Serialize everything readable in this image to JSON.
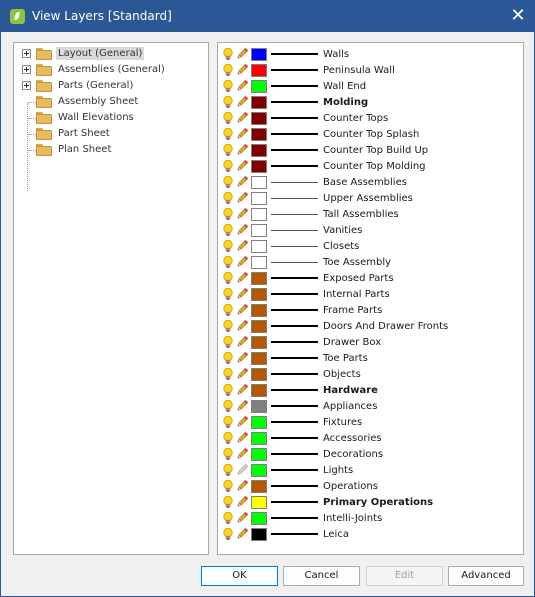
{
  "window": {
    "title": "View Layers [Standard]"
  },
  "colors": {
    "titlebar": "#2b5797",
    "accent": "#0078d7"
  },
  "tree": {
    "items": [
      {
        "label": "Layout (General)",
        "expandable": true,
        "selected": true
      },
      {
        "label": "Assemblies (General)",
        "expandable": true,
        "selected": false
      },
      {
        "label": "Parts (General)",
        "expandable": true,
        "selected": false
      },
      {
        "label": "Assembly Sheet",
        "expandable": false,
        "selected": false
      },
      {
        "label": "Wall Elevations",
        "expandable": false,
        "selected": false
      },
      {
        "label": "Part Sheet",
        "expandable": false,
        "selected": false
      },
      {
        "label": "Plan Sheet",
        "expandable": false,
        "selected": false
      }
    ]
  },
  "layers": [
    {
      "name": "Walls",
      "color": "#0000ff",
      "bold": false,
      "line": "thick",
      "pencil_enabled": true
    },
    {
      "name": "Peninsula Wall",
      "color": "#ff0000",
      "bold": false,
      "line": "thick",
      "pencil_enabled": true
    },
    {
      "name": "Wall End",
      "color": "#00ff00",
      "bold": false,
      "line": "thick",
      "pencil_enabled": true
    },
    {
      "name": "Molding",
      "color": "#800000",
      "bold": true,
      "line": "thick",
      "pencil_enabled": true
    },
    {
      "name": "Counter Tops",
      "color": "#800000",
      "bold": false,
      "line": "thick",
      "pencil_enabled": true
    },
    {
      "name": "Counter Top Splash",
      "color": "#800000",
      "bold": false,
      "line": "thick",
      "pencil_enabled": true
    },
    {
      "name": "Counter Top Build Up",
      "color": "#800000",
      "bold": false,
      "line": "thick",
      "pencil_enabled": true
    },
    {
      "name": "Counter Top Molding",
      "color": "#800000",
      "bold": false,
      "line": "thick",
      "pencil_enabled": true
    },
    {
      "name": "Base Assemblies",
      "color": "#ffffff",
      "bold": false,
      "line": "thin",
      "pencil_enabled": true
    },
    {
      "name": "Upper Assemblies",
      "color": "#ffffff",
      "bold": false,
      "line": "thin",
      "pencil_enabled": true
    },
    {
      "name": "Tall Assemblies",
      "color": "#ffffff",
      "bold": false,
      "line": "thin",
      "pencil_enabled": true
    },
    {
      "name": "Vanities",
      "color": "#ffffff",
      "bold": false,
      "line": "thin",
      "pencil_enabled": true
    },
    {
      "name": "Closets",
      "color": "#ffffff",
      "bold": false,
      "line": "thin",
      "pencil_enabled": true
    },
    {
      "name": "Toe Assembly",
      "color": "#ffffff",
      "bold": false,
      "line": "thin",
      "pencil_enabled": true
    },
    {
      "name": "Exposed Parts",
      "color": "#b35900",
      "bold": false,
      "line": "thick",
      "pencil_enabled": true
    },
    {
      "name": "Internal Parts",
      "color": "#b35900",
      "bold": false,
      "line": "thick",
      "pencil_enabled": true
    },
    {
      "name": "Frame Parts",
      "color": "#b35900",
      "bold": false,
      "line": "thick",
      "pencil_enabled": true
    },
    {
      "name": "Doors And Drawer Fronts",
      "color": "#b35900",
      "bold": false,
      "line": "thick",
      "pencil_enabled": true
    },
    {
      "name": "Drawer Box",
      "color": "#b35900",
      "bold": false,
      "line": "thick",
      "pencil_enabled": true
    },
    {
      "name": "Toe Parts",
      "color": "#b35900",
      "bold": false,
      "line": "thick",
      "pencil_enabled": true
    },
    {
      "name": "Objects",
      "color": "#b35900",
      "bold": false,
      "line": "thick",
      "pencil_enabled": true
    },
    {
      "name": "Hardware",
      "color": "#b35900",
      "bold": true,
      "line": "thick",
      "pencil_enabled": true
    },
    {
      "name": "Appliances",
      "color": "#808080",
      "bold": false,
      "line": "thick",
      "pencil_enabled": true
    },
    {
      "name": "Fixtures",
      "color": "#00ff00",
      "bold": false,
      "line": "thick",
      "pencil_enabled": true
    },
    {
      "name": "Accessories",
      "color": "#00ff00",
      "bold": false,
      "line": "thick",
      "pencil_enabled": true
    },
    {
      "name": "Decorations",
      "color": "#00ff00",
      "bold": false,
      "line": "thick",
      "pencil_enabled": true
    },
    {
      "name": "Lights",
      "color": "#00ff00",
      "bold": false,
      "line": "thick",
      "pencil_enabled": false
    },
    {
      "name": "Operations",
      "color": "#b35900",
      "bold": false,
      "line": "thick",
      "pencil_enabled": true
    },
    {
      "name": "Primary Operations",
      "color": "#ffff00",
      "bold": true,
      "line": "thick",
      "pencil_enabled": true
    },
    {
      "name": "Intelli-Joints",
      "color": "#00ff00",
      "bold": false,
      "line": "thick",
      "pencil_enabled": true
    },
    {
      "name": "Leica",
      "color": "#000000",
      "bold": false,
      "line": "thick",
      "pencil_enabled": true
    }
  ],
  "buttons": {
    "ok": "OK",
    "cancel": "Cancel",
    "edit": "Edit",
    "advanced": "Advanced"
  }
}
